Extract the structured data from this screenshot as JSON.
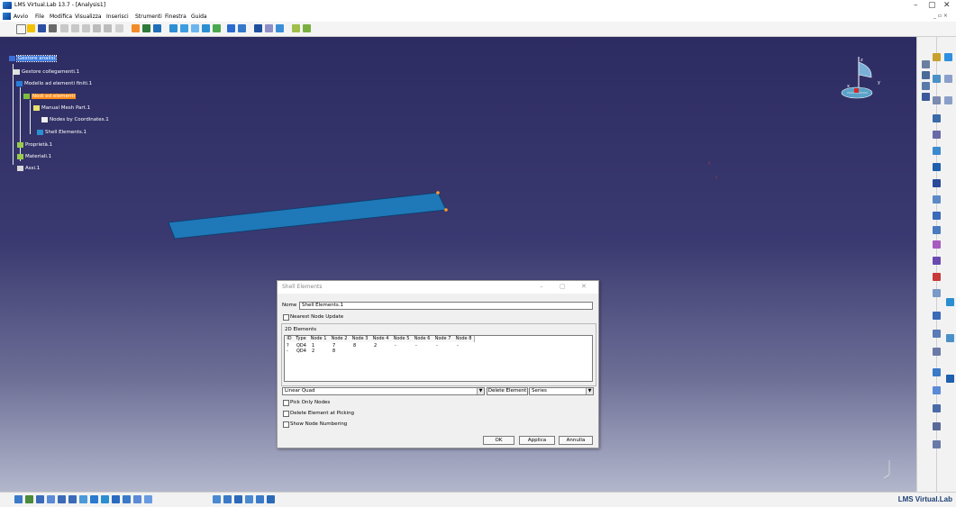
{
  "window": {
    "title": "LMS Virtual.Lab 13.7 - [Analysis1]",
    "minimize": "–",
    "maximize": "▢",
    "close": "✕",
    "mdi_controls": "_ ▫ ×"
  },
  "menu": {
    "items": [
      "Avvio",
      "File",
      "Modifica",
      "Visualizza",
      "Inserisci",
      "Strumenti",
      "Finestra",
      "Guida"
    ]
  },
  "tree": {
    "root": "Gestore analisi",
    "items": [
      "Gestore collegamenti.1",
      "Modello ad elementi finiti.1",
      "Nodi ed elementi",
      "Manual Mesh Part.1",
      "Nodes by Coordinates.1",
      "Shell Elements.1",
      "Proprietà.1",
      "Materiali.1",
      "Assi.1"
    ]
  },
  "compass": {
    "x_label": "x",
    "y_label": "y",
    "z_label": "z"
  },
  "dialog": {
    "title": "Shell Elements",
    "name_label": "Nome",
    "name_value": "Shell Elements.1",
    "nearest_node_update": "Nearest Node Update",
    "elements_group": "2D Elements",
    "table": {
      "columns": [
        "ID",
        "Type",
        "Node 1",
        "Node 2",
        "Node 3",
        "Node 4",
        "Node 5",
        "Node 6",
        "Node 7",
        "Node 8"
      ],
      "rows": [
        [
          "?",
          "QD4",
          "1",
          "7",
          "8",
          "2",
          "-",
          "-",
          "-",
          "-"
        ],
        [
          "-",
          "QD4",
          "2",
          "8",
          "",
          "",
          "",
          "",
          "",
          ""
        ]
      ]
    },
    "element_type": "Linear Quad",
    "delete_element": "Delete Element",
    "mode": "Series",
    "pick_only_nodes": "Pick Only Nodes",
    "delete_at_picking": "Delete Element at Picking",
    "show_node_numbering": "Show Node Numbering",
    "ok": "OK",
    "apply": "Applica",
    "cancel": "Annulla"
  },
  "brand": "LMS Virtual.Lab",
  "colors": {
    "highlight": "#ff8c1a",
    "selection": "#3b7be0",
    "shell": "#1f78b8"
  }
}
